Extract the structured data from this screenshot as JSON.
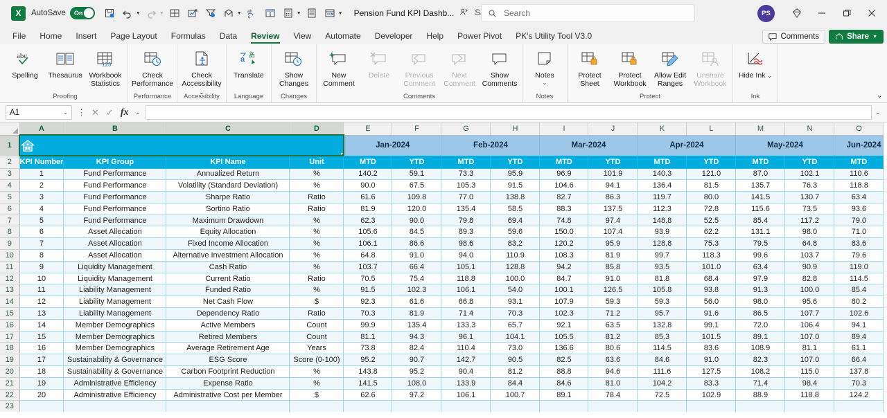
{
  "titlebar": {
    "autosave_label": "AutoSave",
    "autosave_state": "On",
    "document_title": "Pension Fund KPI Dashb...",
    "saved_state": "Saved",
    "search_placeholder": "Search",
    "avatar_initials": "PS"
  },
  "tabs": [
    {
      "label": "File",
      "active": false
    },
    {
      "label": "Home",
      "active": false
    },
    {
      "label": "Insert",
      "active": false
    },
    {
      "label": "Page Layout",
      "active": false
    },
    {
      "label": "Formulas",
      "active": false
    },
    {
      "label": "Data",
      "active": false
    },
    {
      "label": "Review",
      "active": true
    },
    {
      "label": "View",
      "active": false
    },
    {
      "label": "Automate",
      "active": false
    },
    {
      "label": "Developer",
      "active": false
    },
    {
      "label": "Help",
      "active": false
    },
    {
      "label": "Power Pivot",
      "active": false
    },
    {
      "label": "PK's Utility Tool V3.0",
      "active": false
    }
  ],
  "tabs_right": {
    "comments_label": "Comments",
    "share_label": "Share"
  },
  "ribbon": {
    "groups": [
      {
        "label": "Proofing",
        "buttons": [
          {
            "label": "Spelling",
            "dim": false
          },
          {
            "label": "Thesaurus",
            "dim": false
          },
          {
            "label": "Workbook Statistics",
            "dim": false
          }
        ]
      },
      {
        "label": "Performance",
        "buttons": [
          {
            "label": "Check Performance",
            "dim": false
          }
        ]
      },
      {
        "label": "Accessibility",
        "buttons": [
          {
            "label": "Check Accessibility",
            "dim": false
          }
        ]
      },
      {
        "label": "Language",
        "buttons": [
          {
            "label": "Translate",
            "dim": false
          }
        ]
      },
      {
        "label": "Changes",
        "buttons": [
          {
            "label": "Show Changes",
            "dim": false
          }
        ]
      },
      {
        "label": "Comments",
        "buttons": [
          {
            "label": "New Comment",
            "dim": false
          },
          {
            "label": "Delete",
            "dim": true
          },
          {
            "label": "Previous Comment",
            "dim": true
          },
          {
            "label": "Next Comment",
            "dim": true
          },
          {
            "label": "Show Comments",
            "dim": false
          }
        ]
      },
      {
        "label": "Notes",
        "buttons": [
          {
            "label": "Notes",
            "dim": false
          }
        ]
      },
      {
        "label": "Protect",
        "buttons": [
          {
            "label": "Protect Sheet",
            "dim": false
          },
          {
            "label": "Protect Workbook",
            "dim": false
          },
          {
            "label": "Allow Edit Ranges",
            "dim": false
          },
          {
            "label": "Unshare Workbook",
            "dim": true
          }
        ]
      },
      {
        "label": "Ink",
        "buttons": [
          {
            "label": "Hide Ink",
            "dim": false
          }
        ]
      }
    ]
  },
  "formula_bar": {
    "name_box": "A1",
    "formula_value": ""
  },
  "sheet": {
    "column_letters": [
      "A",
      "B",
      "C",
      "D",
      "E",
      "F",
      "G",
      "H",
      "I",
      "J",
      "K",
      "L",
      "M",
      "N",
      "O"
    ],
    "selected_columns": [
      "A",
      "B",
      "C",
      "D"
    ],
    "row_numbers": [
      1,
      2,
      3,
      4,
      5,
      6,
      7,
      8,
      9,
      10,
      11,
      12,
      13,
      14,
      15,
      16,
      17,
      18,
      19,
      20,
      21,
      22,
      23
    ],
    "selected_rows": [
      1
    ],
    "banner_row": {
      "home_icon": "house-icon",
      "months": [
        "Jan-2024",
        "Feb-2024",
        "Mar-2024",
        "Apr-2024",
        "May-2024",
        "Jun-2024"
      ]
    },
    "header_row": {
      "fixed": [
        "KPI Number",
        "KPI Group",
        "KPI Name",
        "Unit"
      ],
      "metric_pair": [
        "MTD",
        "YTD"
      ]
    },
    "rows": [
      {
        "num": 1,
        "group": "Fund Performance",
        "name": "Annualized Return",
        "unit": "%",
        "values": [
          140.2,
          59.1,
          73.3,
          95.9,
          96.9,
          101.9,
          140.3,
          121.0,
          87.0,
          102.1,
          110.6
        ]
      },
      {
        "num": 2,
        "group": "Fund Performance",
        "name": "Volatility (Standard Deviation)",
        "unit": "%",
        "values": [
          90.0,
          67.5,
          105.3,
          91.5,
          104.6,
          94.1,
          136.4,
          81.5,
          135.7,
          76.3,
          118.8
        ]
      },
      {
        "num": 3,
        "group": "Fund Performance",
        "name": "Sharpe Ratio",
        "unit": "Ratio",
        "values": [
          61.6,
          109.8,
          77.0,
          138.8,
          82.7,
          86.3,
          119.7,
          80.0,
          141.5,
          130.7,
          63.4
        ]
      },
      {
        "num": 4,
        "group": "Fund Performance",
        "name": "Sortino Ratio",
        "unit": "Ratio",
        "values": [
          81.9,
          120.0,
          135.4,
          58.5,
          88.3,
          137.5,
          112.3,
          72.8,
          115.6,
          73.5,
          93.6
        ]
      },
      {
        "num": 5,
        "group": "Fund Performance",
        "name": "Maximum Drawdown",
        "unit": "%",
        "values": [
          62.3,
          90.0,
          79.8,
          69.4,
          74.8,
          97.4,
          148.8,
          52.5,
          85.4,
          117.2,
          79.0
        ]
      },
      {
        "num": 6,
        "group": "Asset Allocation",
        "name": "Equity Allocation",
        "unit": "%",
        "values": [
          105.6,
          84.5,
          89.3,
          59.6,
          150.0,
          107.4,
          93.9,
          62.2,
          131.1,
          98.0,
          71.0
        ]
      },
      {
        "num": 7,
        "group": "Asset Allocation",
        "name": "Fixed Income Allocation",
        "unit": "%",
        "values": [
          106.1,
          86.6,
          98.6,
          83.2,
          120.2,
          95.9,
          128.8,
          75.3,
          79.5,
          64.8,
          83.6
        ]
      },
      {
        "num": 8,
        "group": "Asset Allocation",
        "name": "Alternative Investment Allocation",
        "unit": "%",
        "values": [
          64.8,
          91.0,
          94.0,
          110.9,
          108.3,
          81.9,
          99.7,
          118.3,
          99.6,
          103.7,
          79.6
        ]
      },
      {
        "num": 9,
        "group": "Liquidity Management",
        "name": "Cash Ratio",
        "unit": "%",
        "values": [
          103.7,
          66.4,
          105.1,
          128.8,
          94.2,
          85.8,
          93.5,
          101.0,
          63.4,
          90.9,
          119.0
        ]
      },
      {
        "num": 10,
        "group": "Liquidity Management",
        "name": "Current Ratio",
        "unit": "Ratio",
        "values": [
          70.5,
          75.4,
          118.8,
          100.0,
          84.7,
          91.0,
          81.8,
          68.4,
          97.9,
          82.8,
          114.5
        ]
      },
      {
        "num": 11,
        "group": "Liability Management",
        "name": "Funded Ratio",
        "unit": "%",
        "values": [
          91.5,
          102.3,
          106.1,
          54.0,
          100.1,
          126.5,
          105.8,
          93.8,
          91.3,
          100.0,
          85.4
        ]
      },
      {
        "num": 12,
        "group": "Liability Management",
        "name": "Net Cash Flow",
        "unit": "$",
        "values": [
          92.3,
          61.6,
          66.8,
          93.1,
          107.9,
          59.3,
          59.3,
          56.0,
          98.0,
          95.6,
          80.2
        ]
      },
      {
        "num": 13,
        "group": "Liability Management",
        "name": "Dependency Ratio",
        "unit": "Ratio",
        "values": [
          70.3,
          81.9,
          71.4,
          70.3,
          102.3,
          71.2,
          95.7,
          91.6,
          86.5,
          107.7,
          102.6
        ]
      },
      {
        "num": 14,
        "group": "Member Demographics",
        "name": "Active Members",
        "unit": "Count",
        "values": [
          99.9,
          135.4,
          133.3,
          65.7,
          92.1,
          63.5,
          132.8,
          99.1,
          72.0,
          106.4,
          94.1
        ]
      },
      {
        "num": 15,
        "group": "Member Demographics",
        "name": "Retired Members",
        "unit": "Count",
        "values": [
          81.1,
          94.3,
          96.1,
          104.1,
          105.5,
          81.2,
          85.3,
          101.5,
          89.1,
          107.0,
          89.4
        ]
      },
      {
        "num": 16,
        "group": "Member Demographics",
        "name": "Average Retirement Age",
        "unit": "Years",
        "values": [
          73.8,
          82.4,
          110.4,
          73.0,
          136.6,
          80.6,
          114.5,
          83.6,
          108.9,
          81.1,
          61.1
        ]
      },
      {
        "num": 17,
        "group": "Sustainability & Governance",
        "name": "ESG Score",
        "unit": "Score (0-100)",
        "values": [
          95.2,
          90.7,
          142.7,
          90.5,
          82.5,
          63.6,
          84.6,
          91.0,
          82.3,
          107.0,
          66.4
        ]
      },
      {
        "num": 18,
        "group": "Sustainability & Governance",
        "name": "Carbon Footprint Reduction",
        "unit": "%",
        "values": [
          143.8,
          95.2,
          90.4,
          81.2,
          88.8,
          94.6,
          111.6,
          127.5,
          108.2,
          115.0,
          137.8
        ]
      },
      {
        "num": 19,
        "group": "Administrative Efficiency",
        "name": "Expense Ratio",
        "unit": "%",
        "values": [
          141.5,
          108.0,
          133.9,
          84.4,
          84.6,
          81.0,
          104.2,
          83.3,
          71.4,
          98.4,
          70.3
        ]
      },
      {
        "num": 20,
        "group": "Administrative Efficiency",
        "name": "Administrative Cost per Member",
        "unit": "$",
        "values": [
          62.6,
          97.2,
          106.1,
          100.7,
          89.1,
          78.4,
          72.5,
          102.9,
          88.9,
          118.8,
          124.2
        ]
      }
    ]
  },
  "colors": {
    "excel_green": "#107c41",
    "header_cyan": "#00adde",
    "month_blue": "#9cc7e8",
    "row_stripe": "#eef8fc",
    "grid_line": "#9fd7ef"
  }
}
